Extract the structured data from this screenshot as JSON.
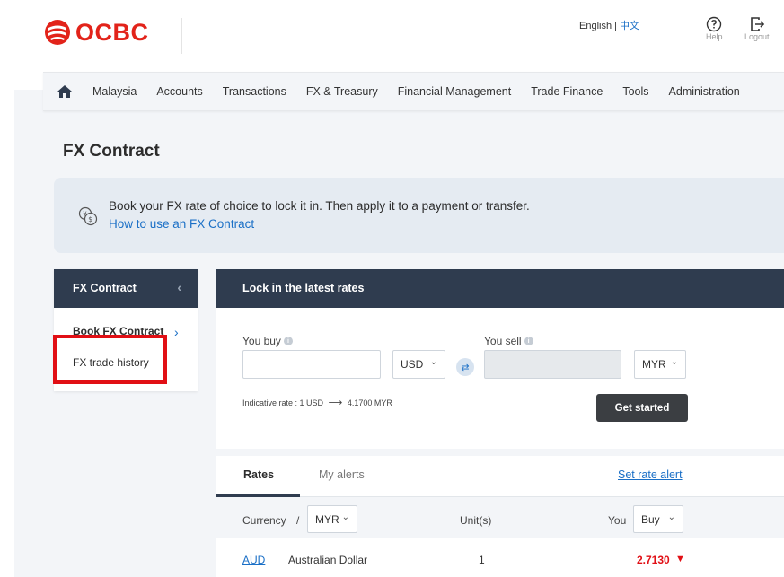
{
  "header": {
    "brand": "OCBC",
    "lang_en": "English",
    "lang_sep": "|",
    "lang_zh": "中文",
    "help_label": "Help",
    "logout_label": "Logout"
  },
  "nav": {
    "items": [
      "Malaysia",
      "Accounts",
      "Transactions",
      "FX & Treasury",
      "Financial Management",
      "Trade Finance",
      "Tools",
      "Administration"
    ]
  },
  "page_title": "FX Contract",
  "banner": {
    "text": "Book your FX rate of choice to lock it in. Then apply it to a payment or transfer.",
    "link": "How to use an FX Contract"
  },
  "side": {
    "title": "FX Contract",
    "items": [
      "Book FX Contract",
      "FX trade history"
    ]
  },
  "main": {
    "title": "Lock in the latest rates",
    "you_buy_label": "You buy",
    "you_sell_label": "You sell",
    "buy_currency": "USD",
    "sell_currency": "MYR",
    "indicative_prefix": "Indicative rate : 1 USD",
    "indicative_value": "4.1700 MYR",
    "get_started": "Get started"
  },
  "rates": {
    "tabs": [
      "Rates",
      "My alerts"
    ],
    "set_alert": "Set rate alert",
    "currency_label": "Currency",
    "slash": "/",
    "currency_value": "MYR",
    "units_label": "Unit(s)",
    "you_label": "You",
    "side_value": "Buy",
    "rows": [
      {
        "code": "AUD",
        "name": "Australian Dollar",
        "unit": "1",
        "rate": "2.7130"
      }
    ]
  },
  "colors": {
    "brand_red": "#e2231a",
    "navy": "#2f3c4f",
    "link_blue": "#1a6fc6",
    "highlight_red": "#e10f15"
  }
}
